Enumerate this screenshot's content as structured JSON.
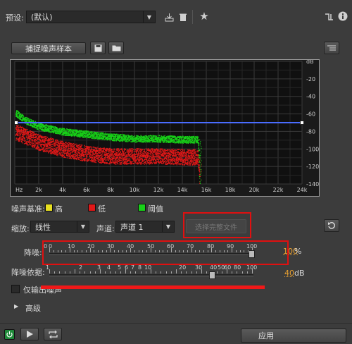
{
  "top": {
    "preset_label": "预设:",
    "preset_value": "(默认)"
  },
  "capture_button": "捕捉噪声样本",
  "chart_data": {
    "type": "area",
    "x": [
      "Hz",
      "2k",
      "4k",
      "6k",
      "8k",
      "10k",
      "12k",
      "14k",
      "16k",
      "18k",
      "20k",
      "22k",
      "24k"
    ],
    "y_ticks": [
      "dB",
      "-20",
      "-40",
      "-60",
      "-80",
      "-100",
      "-120",
      "-140"
    ],
    "xlabel": "",
    "ylabel": "",
    "ylim": [
      -140,
      0
    ],
    "xlim": [
      0,
      24000
    ],
    "grid": true,
    "threshold_db": -70,
    "series": [
      {
        "name": "阈值",
        "color": "#18d018",
        "points": [
          [
            0,
            -58
          ],
          [
            1000,
            -68
          ],
          [
            2000,
            -74
          ],
          [
            4000,
            -80
          ],
          [
            6000,
            -83
          ],
          [
            8000,
            -86
          ],
          [
            10000,
            -88
          ],
          [
            12000,
            -88
          ],
          [
            14000,
            -89
          ],
          [
            15300,
            -89
          ],
          [
            15500,
            -140
          ]
        ]
      },
      {
        "name": "低",
        "color": "#e01818",
        "points": [
          [
            0,
            -80
          ],
          [
            1000,
            -86
          ],
          [
            2000,
            -92
          ],
          [
            4000,
            -100
          ],
          [
            6000,
            -105
          ],
          [
            8000,
            -108
          ],
          [
            10000,
            -108
          ],
          [
            12000,
            -108
          ],
          [
            14000,
            -109
          ],
          [
            15300,
            -109
          ],
          [
            15500,
            -140
          ]
        ]
      }
    ]
  },
  "legend": {
    "title": "噪声基准:",
    "items": [
      {
        "label": "高",
        "color": "#e8e020"
      },
      {
        "label": "低",
        "color": "#e01818"
      },
      {
        "label": "阈值",
        "color": "#18d018"
      }
    ]
  },
  "controls": {
    "scale_label": "缩放:",
    "scale_value": "线性",
    "channel_label": "声道:",
    "channel_value": "声道 1",
    "select_file": "选择完整文件"
  },
  "reduction": {
    "label": "降噪:",
    "ticks": [
      "0",
      "0",
      "10",
      "20",
      "30",
      "40",
      "50",
      "60",
      "70",
      "80",
      "90",
      "100"
    ],
    "value": "100",
    "unit": "%"
  },
  "reduce_by": {
    "label": "降噪依据:",
    "ticks": [
      "1",
      "2",
      "3",
      "4",
      "5",
      "6",
      "7",
      "8",
      "10",
      "20",
      "30",
      "40",
      "50",
      "60",
      "80",
      "100"
    ],
    "value": "40",
    "unit": "dB"
  },
  "output_noise_label": "仅输出噪声",
  "advanced_label": "高级",
  "apply_label": "应用"
}
